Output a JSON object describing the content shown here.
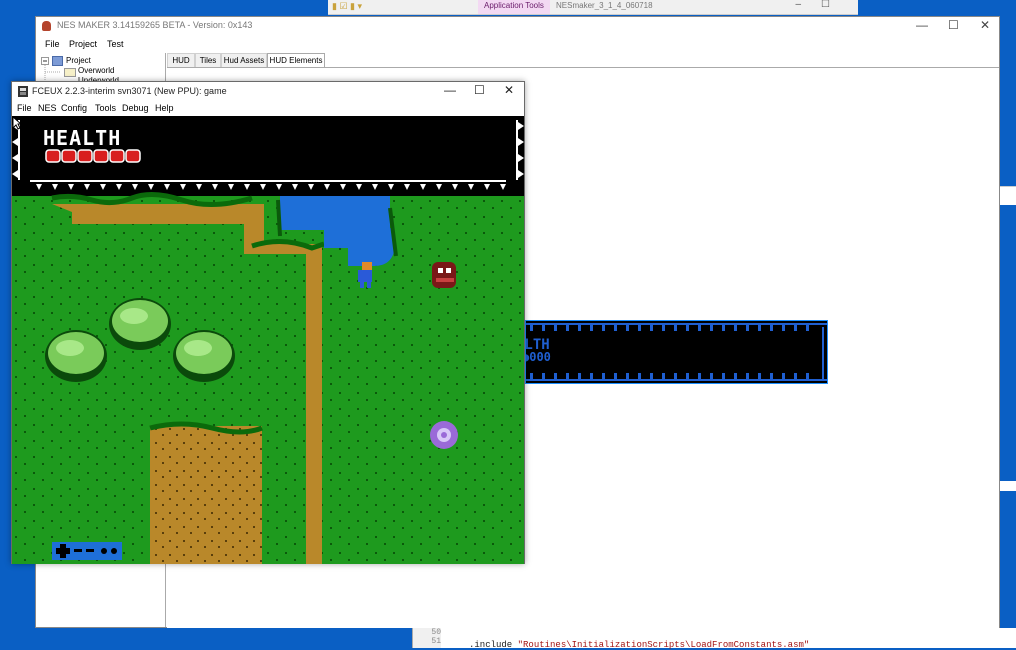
{
  "background": {
    "explorer_ribbon": {
      "tab_label": "Application Tools",
      "breadcrumb": "NESmaker_3_1_4_060718"
    },
    "code_editor": {
      "line_numbers": [
        "50",
        "51"
      ],
      "code_keyword": ".include",
      "code_string": "\"Routines\\InitializationScripts\\LoadFromConstants.asm\""
    }
  },
  "nesmaker": {
    "title": "NES MAKER 3.14159265 BETA - Version: 0x143",
    "menu": [
      "File",
      "Project",
      "Test"
    ],
    "tree": {
      "root": "Project",
      "children": [
        "Overworld",
        "Underworld"
      ]
    },
    "tabs": [
      "HUD",
      "Tiles",
      "Hud Assets",
      "HUD Elements"
    ],
    "active_tab": "HUD Elements",
    "hud_preview": {
      "line1": "ALTH",
      "line2": "●000"
    }
  },
  "fceux": {
    "title": "FCEUX 2.2.3-interim svn3071 (New PPU): game",
    "menu": [
      "File",
      "NES",
      "Config",
      "Tools",
      "Debug",
      "Help"
    ],
    "hud": {
      "label": "HEALTH",
      "health_cells": 6
    },
    "colors": {
      "grass": "#1e9a1e",
      "path": "#b9882a",
      "water": "#1e6fd8",
      "hud_bg": "#000000"
    }
  },
  "window_controls": {
    "minimize": "—",
    "maximize": "☐",
    "close": "✕"
  }
}
